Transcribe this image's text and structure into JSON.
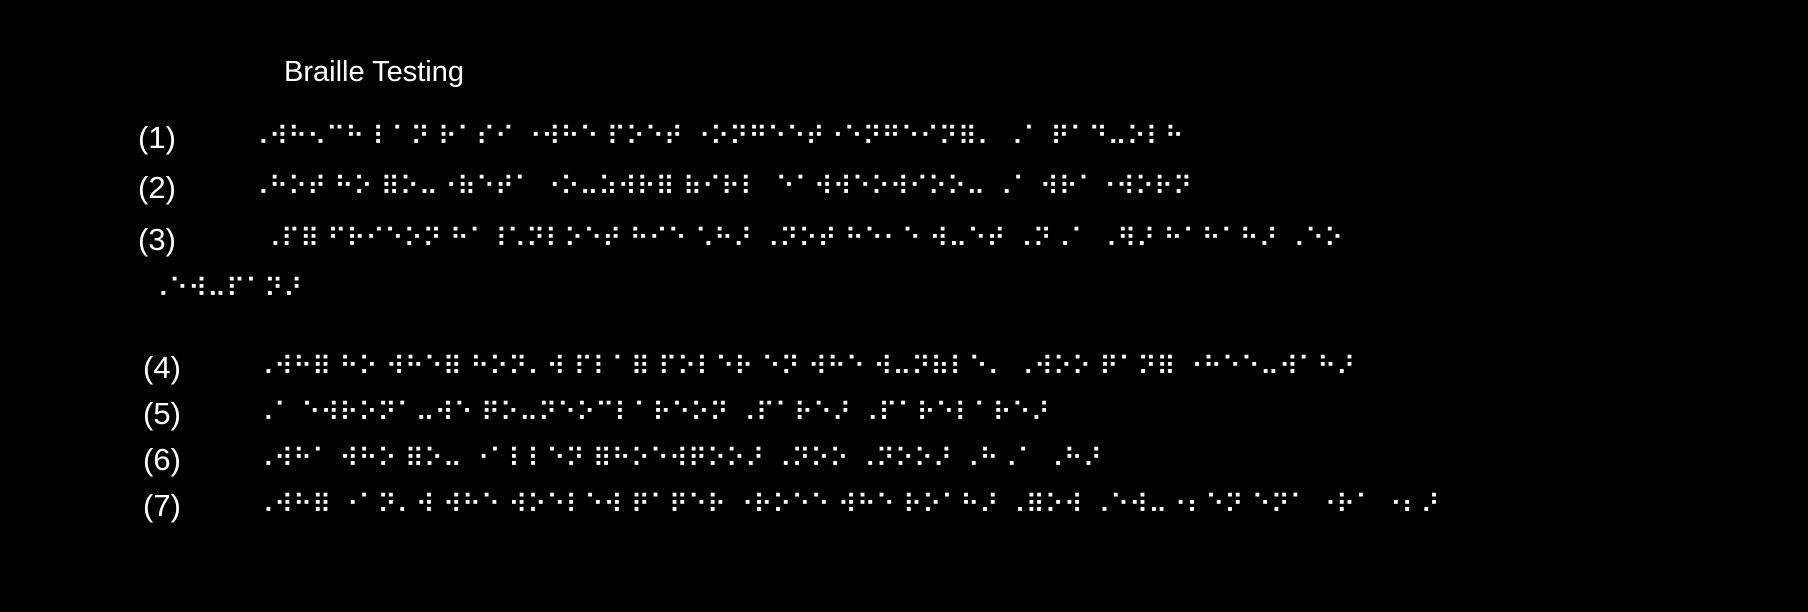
{
  "title": "Braille Testing",
  "lines": [
    {
      "number": "(1)",
      "braille": "⠠⠺⠓⠢⠉⠓ ⠇⠁⠝ ⠗⠁⠎⠊ ⠐⠺⠓⠑ ⠏⠕⠑⠞ ⠐⠕⠝⠛⠑⠑⠞⠐⠑⠝⠛⠑⠊⠝⠿⠄ ⠠⠁ ⠟⠁⠙⠤⠕⠇⠓"
    },
    {
      "number": "(2)",
      "braille": "⠠⠓⠕⠞ ⠓⠕ ⠿⠕⠤⠐⠷⠑⠞⠁ ⠐⠕⠤⠵⠺⠗⠿ ⠷⠊⠗⠇  ⠑⠁⠺⠺⠑⠕⠺⠊⠕⠕⠤ ⠠⠁ ⠺⠗⠁⠐⠺⠕⠗⠝"
    },
    {
      "number": "(3)",
      "braille": "⠠⠏⠿ ⠋⠗⠊⠑⠕⠝ ⠓⠁⠸⠡⠝⠇⠕⠑⠞ ⠓⠊⠑ ⠡⠓⠜ ⠠⠝⠕⠞ ⠓⠑⠂⠑ ⠺⠤⠑⠞ ⠠⠝⠠⠁ ⠠⠻⠜ ⠓⠁⠓⠁⠓⠜ ⠠⠑⠕"
    },
    {
      "number": "",
      "braille": "⠠⠑⠺⠤⠏⠁⠝⠜"
    },
    {
      "number": "(4)",
      "braille": "⠠⠺⠓⠿ ⠓⠕ ⠺⠓⠑⠿ ⠓⠕⠝⠄⠺ ⠏⠇⠁⠿ ⠏⠕⠇⠑⠗ ⠑⠝ ⠺⠓⠑ ⠺⠤⠝⠷⠇⠑⠄ ⠠⠺⠕⠕ ⠟⠁⠝⠿ ⠐⠓⠑⠑⠤⠺⠁⠓⠜"
    },
    {
      "number": "(5)",
      "braille": "⠠⠁ ⠑⠺⠗⠕⠝⠁⠤⠺⠑ ⠟⠕⠤⠝⠑⠕⠉⠇⠁⠗⠑⠕⠝ ⠠⠏⠁⠗⠑⠜ ⠠⠏⠁⠗⠑⠇⠁⠗⠑⠜"
    },
    {
      "number": "(6)",
      "braille": "⠠⠺⠓⠁ ⠺⠓⠕ ⠿⠕⠤ ⠐⠁⠇⠇⠑⠝ ⠿⠓⠕⠑⠺⠟⠕⠕⠜ ⠠⠝⠕⠕ ⠠⠝⠕⠕⠜ ⠠⠓⠠⠁ ⠠⠓⠜"
    },
    {
      "number": "(7)",
      "braille": "⠠⠺⠓⠿ ⠐⠁⠝⠄⠺ ⠺⠓⠑ ⠺⠕⠑⠇⠑⠺ ⠟⠁⠟⠑⠗ ⠐⠗⠕⠑⠑ ⠺⠓⠑ ⠗⠕⠁⠓⠜ ⠠⠿⠕⠺ ⠠⠑⠺⠤⠐⠆⠑⠝ ⠑⠝⠁ ⠐⠗⠁ ⠐⠆⠜"
    }
  ]
}
